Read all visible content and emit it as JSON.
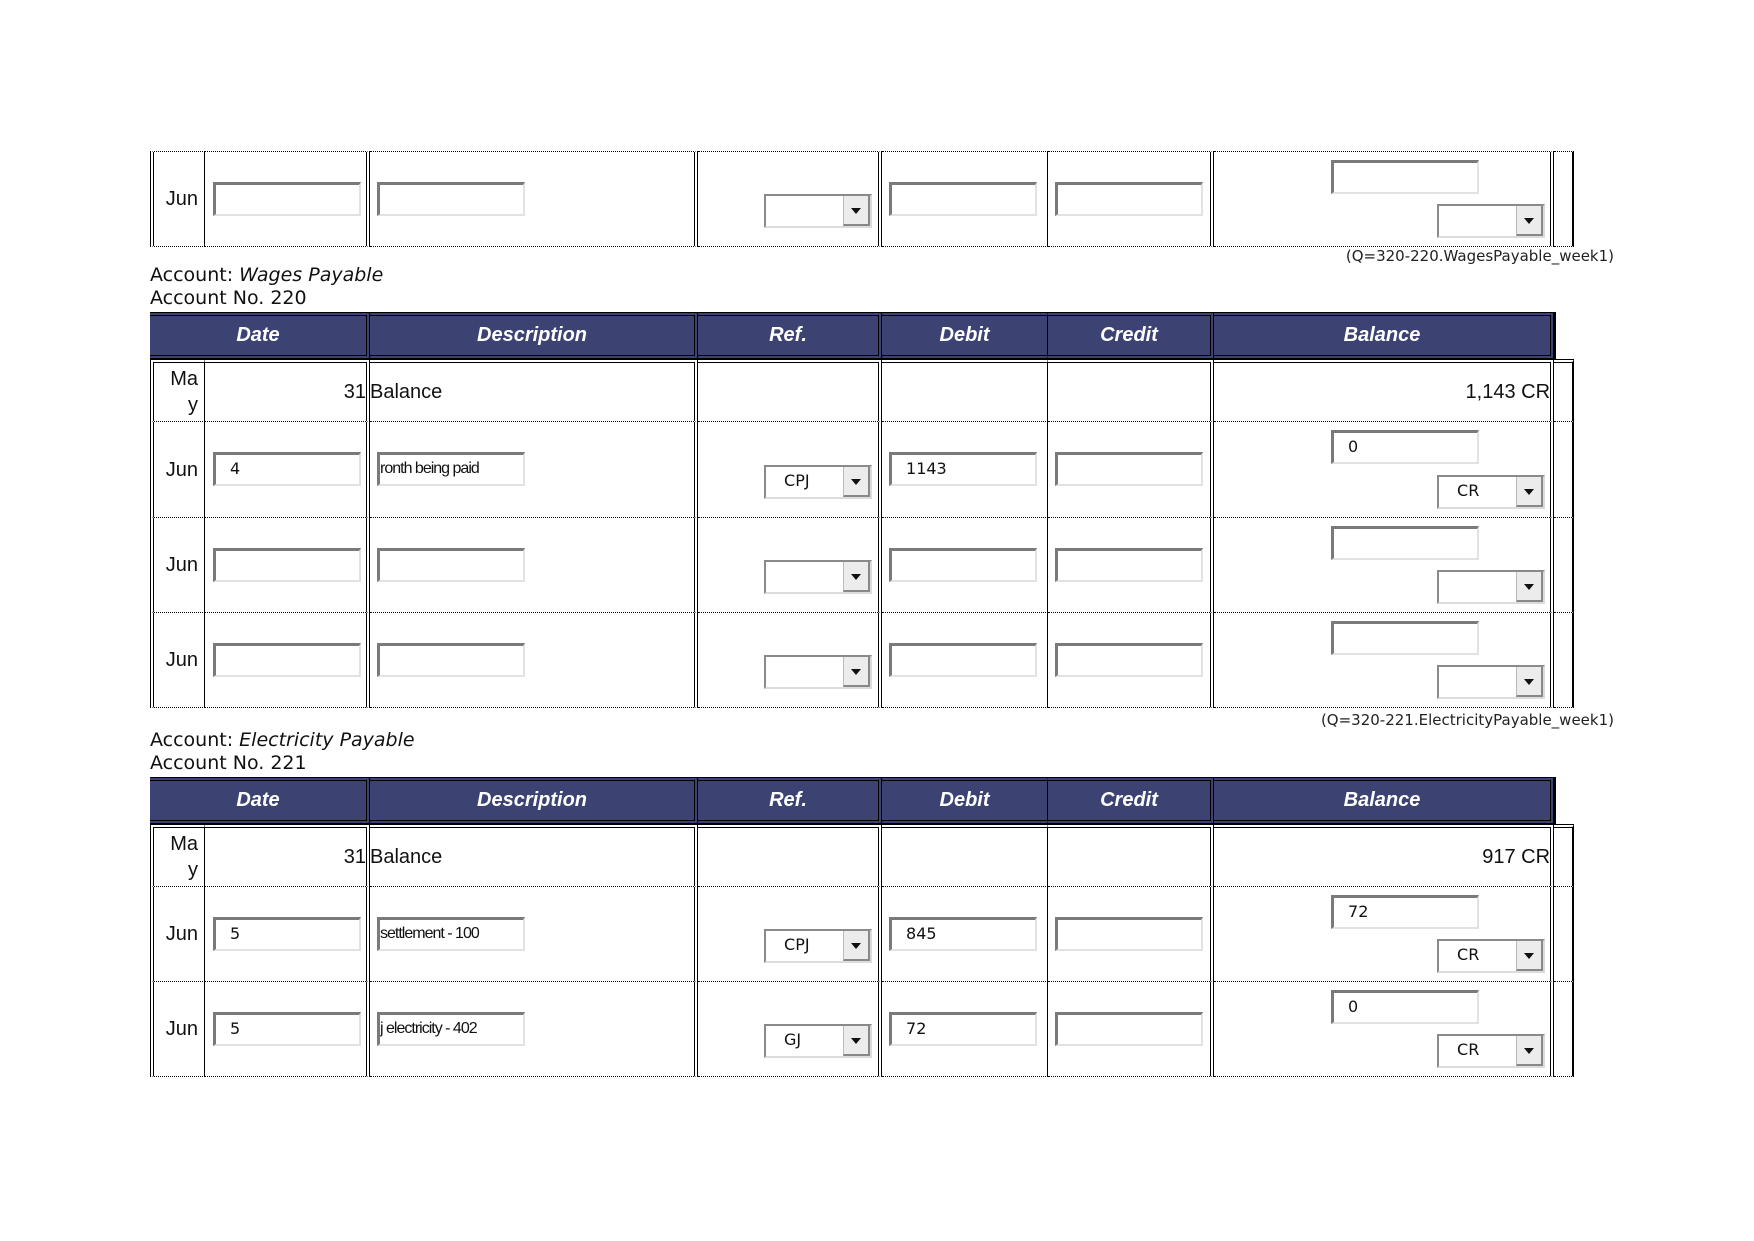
{
  "colors": {
    "header_bg": "#3c4373",
    "header_text": "#ffffff"
  },
  "columns": {
    "date": "Date",
    "description": "Description",
    "ref": "Ref.",
    "debit": "Debit",
    "credit": "Credit",
    "balance": "Balance"
  },
  "top_fragment": {
    "rows": [
      {
        "month": "Jun",
        "day": "",
        "description": "",
        "ref": "",
        "debit": "",
        "credit": "",
        "balance": "",
        "balance_type": ""
      }
    ],
    "qcode": "(Q=320-220.WagesPayable_week1)"
  },
  "accounts": [
    {
      "label": "Account: ",
      "name": "Wages Payable",
      "number_label": "Account No. 220",
      "opening": {
        "month": "May",
        "day": "31",
        "description": "Balance",
        "balance": "1,143 CR"
      },
      "rows": [
        {
          "month": "Jun",
          "day": "4",
          "description": "month being paid",
          "description_visible": "ronth being paid",
          "ref": "CPJ",
          "debit": "1143",
          "credit": "",
          "balance": "0",
          "balance_type": "CR"
        },
        {
          "month": "Jun",
          "day": "",
          "description": "",
          "ref": "",
          "debit": "",
          "credit": "",
          "balance": "",
          "balance_type": ""
        },
        {
          "month": "Jun",
          "day": "",
          "description": "",
          "ref": "",
          "debit": "",
          "credit": "",
          "balance": "",
          "balance_type": ""
        }
      ],
      "qcode": "(Q=320-221.ElectricityPayable_week1)"
    },
    {
      "label": "Account: ",
      "name": "Electricity Payable",
      "number_label": "Account No. 221",
      "opening": {
        "month": "May",
        "day": "31",
        "description": "Balance",
        "balance": "917 CR"
      },
      "rows": [
        {
          "month": "Jun",
          "day": "5",
          "description": "settlement - 100",
          "ref": "CPJ",
          "debit": "845",
          "credit": "",
          "balance": "72",
          "balance_type": "CR"
        },
        {
          "month": "Jun",
          "day": "5",
          "description": "electricity - 402",
          "description_visible": "j electricity - 402",
          "ref": "GJ",
          "debit": "72",
          "credit": "",
          "balance": "0",
          "balance_type": "CR"
        }
      ]
    }
  ]
}
